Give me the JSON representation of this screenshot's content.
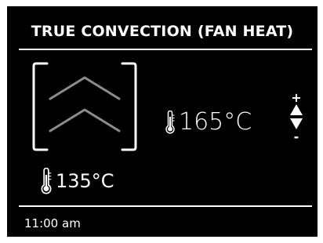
{
  "header": {
    "mode_title": "TRUE CONVECTION (FAN HEAT)"
  },
  "mode_icon": {
    "name": "convection-chevrons-icon"
  },
  "setpoint": {
    "temperature": "165°C",
    "icon": "thermometer-icon"
  },
  "adjust": {
    "increase_symbol": "+",
    "decrease_symbol": "-",
    "icon": "up-down-arrows-icon"
  },
  "current": {
    "temperature": "135°C",
    "icon": "thermometer-icon"
  },
  "status": {
    "time": "11:00 am"
  },
  "colors": {
    "background": "#000000",
    "foreground": "#ffffff",
    "mode_icon_gray": "#8c8c8c"
  }
}
